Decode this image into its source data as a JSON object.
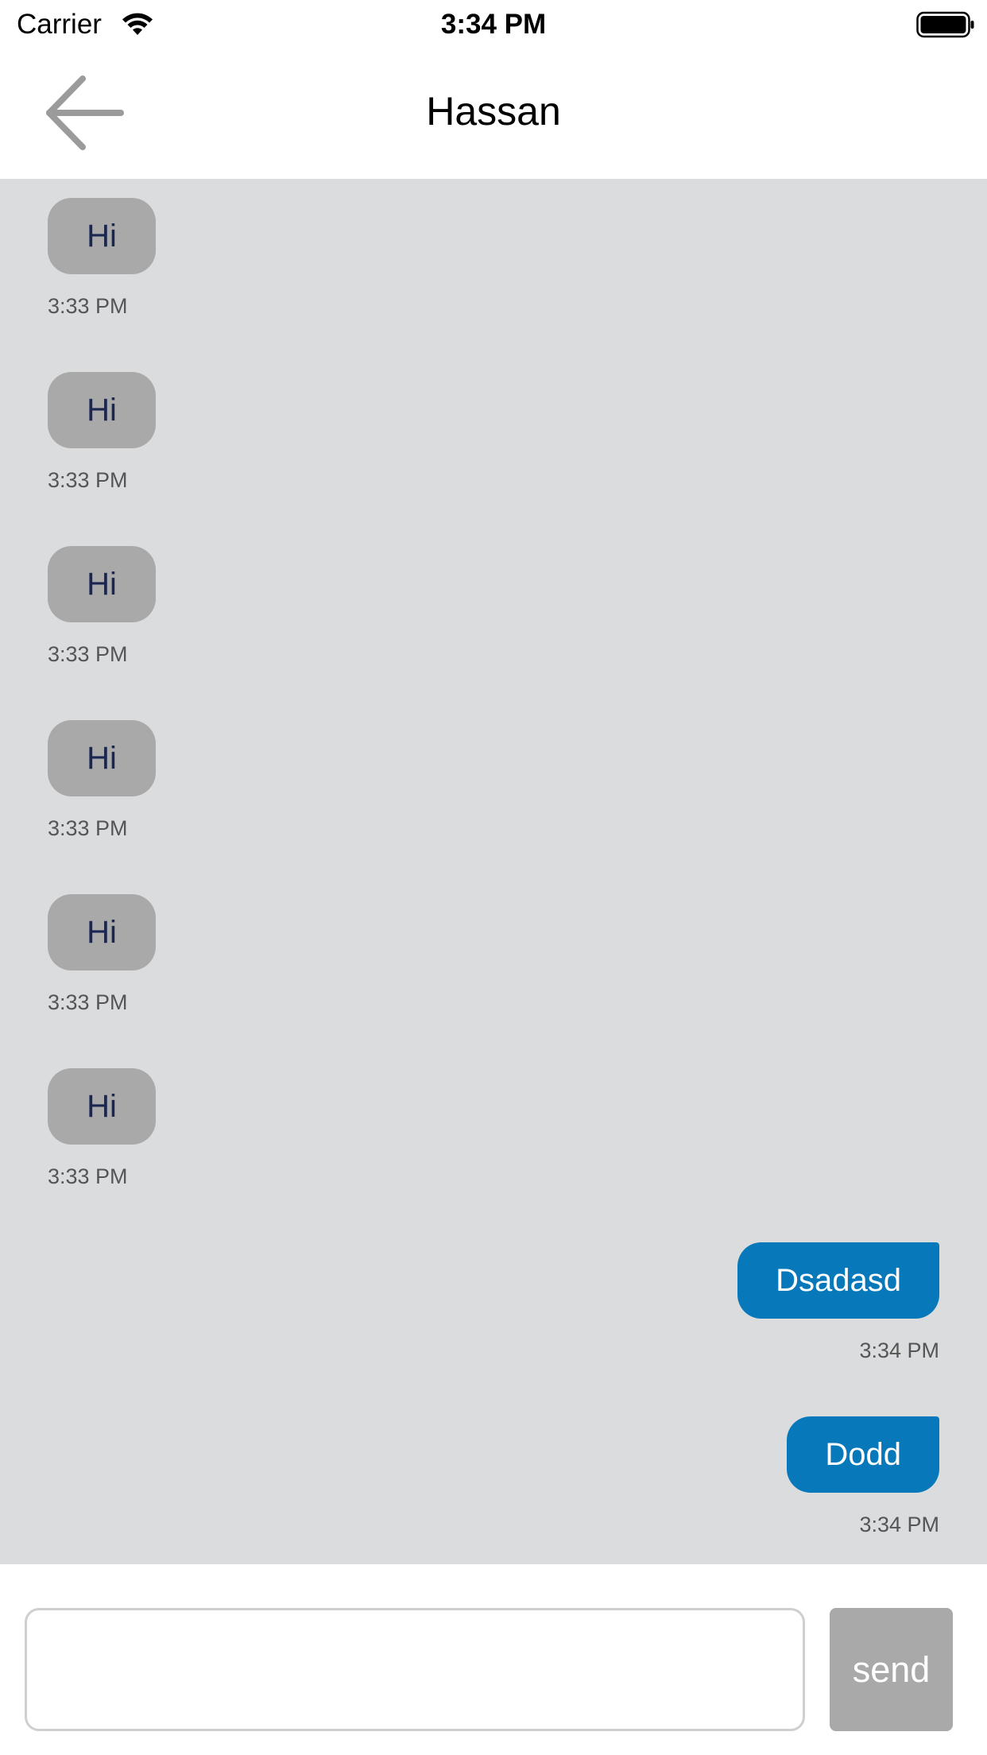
{
  "status_bar": {
    "carrier": "Carrier",
    "time": "3:34 PM",
    "icons": [
      "wifi-icon",
      "battery-icon"
    ]
  },
  "nav": {
    "back_icon": "arrow-left-icon",
    "title": "Hassan"
  },
  "messages": [
    {
      "direction": "incoming",
      "text": "Hi",
      "time": "3:33 PM"
    },
    {
      "direction": "incoming",
      "text": "Hi",
      "time": "3:33 PM"
    },
    {
      "direction": "incoming",
      "text": "Hi",
      "time": "3:33 PM"
    },
    {
      "direction": "incoming",
      "text": "Hi",
      "time": "3:33 PM"
    },
    {
      "direction": "incoming",
      "text": "Hi",
      "time": "3:33 PM"
    },
    {
      "direction": "incoming",
      "text": "Hi",
      "time": "3:33 PM"
    },
    {
      "direction": "outgoing",
      "text": "Dsadasd",
      "time": "3:34 PM"
    },
    {
      "direction": "outgoing",
      "text": "Dodd",
      "time": "3:34 PM"
    }
  ],
  "composer": {
    "input_value": "",
    "send_label": "send"
  },
  "colors": {
    "background_messages": "#dbdcde",
    "incoming_bubble": "#a9a9a9",
    "incoming_text": "#1a2753",
    "outgoing_bubble": "#0779bb",
    "outgoing_text": "#ffffff",
    "send_button": "#a9a9a9"
  }
}
